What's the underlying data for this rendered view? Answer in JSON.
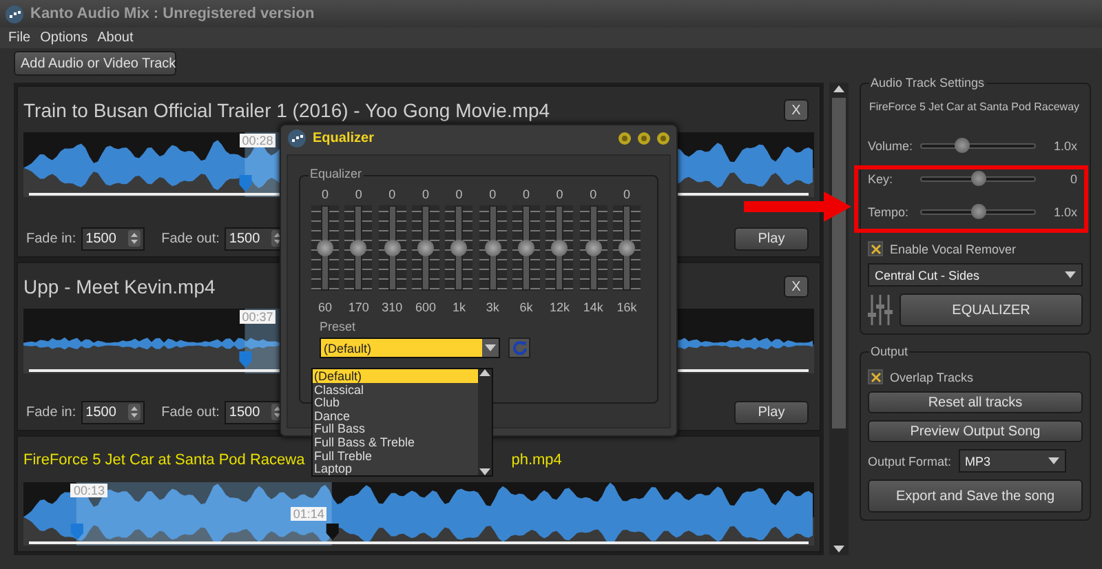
{
  "window": {
    "title": "Kanto Audio Mix : Unregistered version"
  },
  "menu": [
    "File",
    "Options",
    "About"
  ],
  "toolbar": {
    "add_button": "Add Audio or Video Track"
  },
  "tracks": [
    {
      "title": "Train to Busan Official Trailer 1 (2016) - Yoo Gong Movie.mp4",
      "selected": false,
      "close": "X",
      "time_labels": [
        "00:28"
      ],
      "fade_in_label": "Fade in:",
      "fade_in": "1500",
      "fade_out_label": "Fade out:",
      "fade_out": "1500",
      "play": "Play"
    },
    {
      "title": "Upp - Meet Kevin.mp4",
      "selected": false,
      "close": "X",
      "time_labels": [
        "00:37"
      ],
      "fade_in_label": "Fade in:",
      "fade_in": "1500",
      "fade_out_label": "Fade out:",
      "fade_out": "1500",
      "play": "Play"
    },
    {
      "title_start": "FireForce 5 Jet Car at Santa Pod Racewa",
      "title_end": "ph.mp4",
      "selected": true,
      "time_labels": [
        "00:13",
        "01:14"
      ]
    }
  ],
  "equalizer": {
    "title": "Equalizer",
    "group_label": "Equalizer",
    "bands": [
      {
        "value": "0",
        "freq": "60",
        "level": 0.5
      },
      {
        "value": "0",
        "freq": "170",
        "level": 0.5
      },
      {
        "value": "0",
        "freq": "310",
        "level": 0.5
      },
      {
        "value": "0",
        "freq": "600",
        "level": 0.5
      },
      {
        "value": "0",
        "freq": "1k",
        "level": 0.5
      },
      {
        "value": "0",
        "freq": "3k",
        "level": 0.5
      },
      {
        "value": "0",
        "freq": "6k",
        "level": 0.5
      },
      {
        "value": "0",
        "freq": "12k",
        "level": 0.5
      },
      {
        "value": "0",
        "freq": "14k",
        "level": 0.5
      },
      {
        "value": "0",
        "freq": "16k",
        "level": 0.5
      }
    ],
    "preset_label": "Preset",
    "preset": "(Default)",
    "presets": [
      {
        "label": "(Default)",
        "selected": true
      },
      {
        "label": "Classical",
        "selected": false
      },
      {
        "label": "Club",
        "selected": false
      },
      {
        "label": "Dance",
        "selected": false
      },
      {
        "label": "Full Bass",
        "selected": false
      },
      {
        "label": "Full Bass & Treble",
        "selected": false
      },
      {
        "label": "Full Treble",
        "selected": false
      },
      {
        "label": "Laptop",
        "selected": false
      }
    ]
  },
  "settings": {
    "label": "Audio Track Settings",
    "track_name": "FireForce 5 Jet Car at Santa Pod Raceway",
    "sliders": [
      {
        "label": "Volume:",
        "level": 0.35,
        "reading": "1.0x"
      },
      {
        "label": "Key:",
        "level": 0.5,
        "reading": "0"
      },
      {
        "label": "Tempo:",
        "level": 0.5,
        "reading": "1.0x"
      }
    ],
    "vocal_remover": {
      "label": "Enable Vocal Remover",
      "checked": true
    },
    "mode": "Central Cut - Sides",
    "eq_button": "EQUALIZER"
  },
  "output": {
    "label": "Output",
    "overlap": {
      "label": "Overlap Tracks",
      "checked": true
    },
    "reset": "Reset all tracks",
    "preview": "Preview Output Song",
    "format_label": "Output Format:",
    "format": "MP3",
    "export": "Export and Save the song"
  }
}
